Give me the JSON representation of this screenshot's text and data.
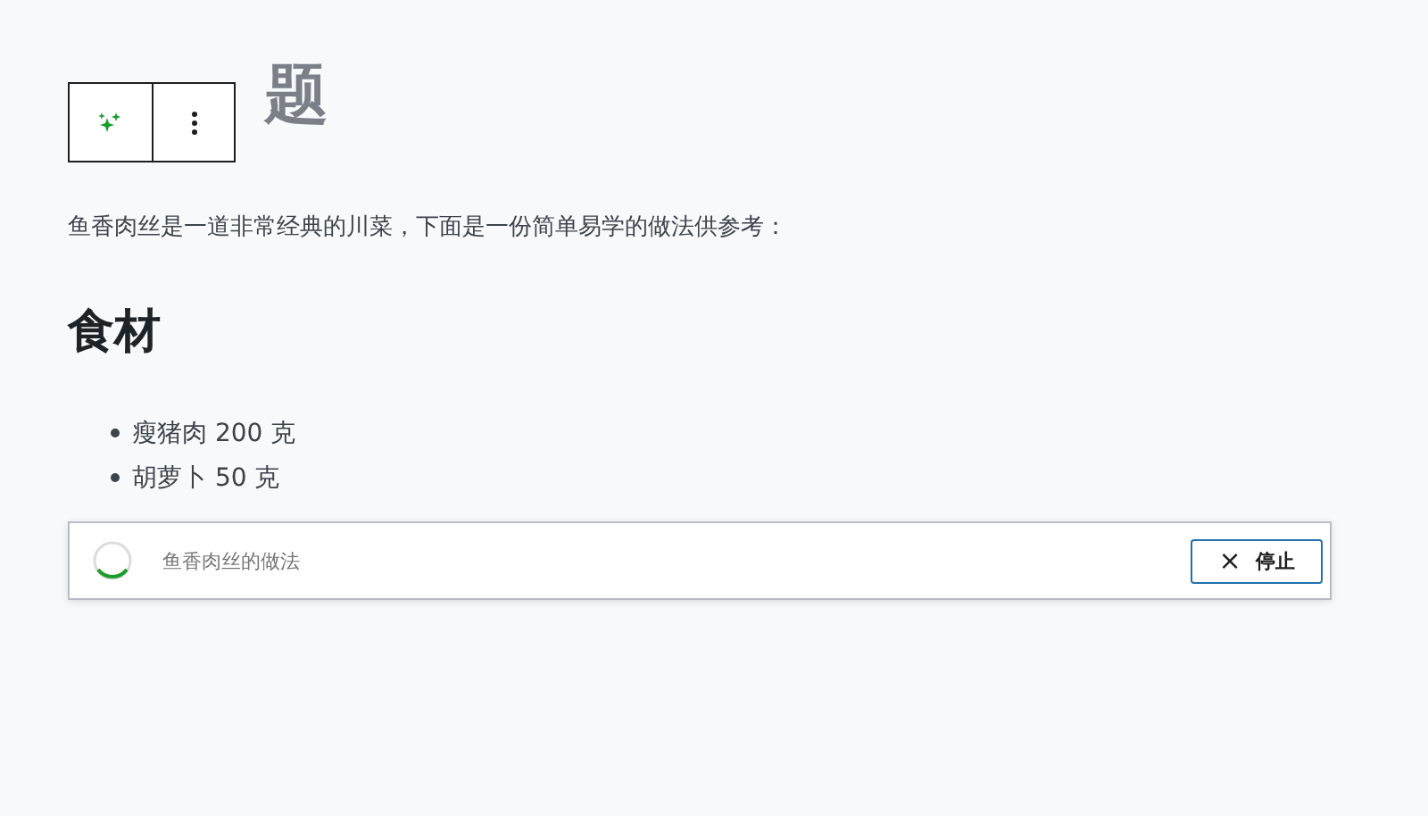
{
  "title": "题",
  "intro": "鱼香肉丝是一道非常经典的川菜，下面是一份简单易学的做法供参考：",
  "section_heading": "食材",
  "ingredients": [
    "瘦猪肉 200 克",
    "胡萝卜 50 克"
  ],
  "ai_bar": {
    "prompt": "鱼香肉丝的做法",
    "stop_button": {
      "icon": "×",
      "label": "停止"
    }
  }
}
